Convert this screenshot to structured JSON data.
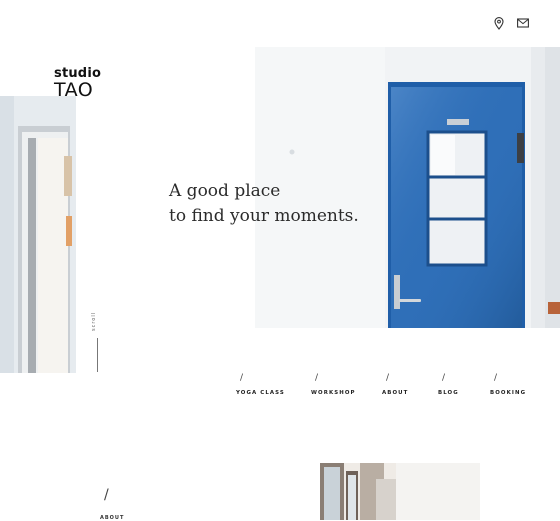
{
  "header": {
    "icons": [
      "map-pin-icon",
      "mail-icon"
    ]
  },
  "logo": {
    "top": "studio",
    "main": "TAO"
  },
  "hero": {
    "tagline_line1": "A good place",
    "tagline_line2": "to find your moments.",
    "scroll_label": "scroll"
  },
  "nav": {
    "items": [
      {
        "label": "YOGA CLASS"
      },
      {
        "label": "WORKSHOP"
      },
      {
        "label": "ABOUT"
      },
      {
        "label": "BLOG"
      },
      {
        "label": "BOOKING"
      }
    ]
  },
  "section": {
    "about_label": "ABOUT"
  },
  "colors": {
    "door_blue": "#2f6fb8",
    "text": "#222222",
    "background": "#ffffff"
  }
}
